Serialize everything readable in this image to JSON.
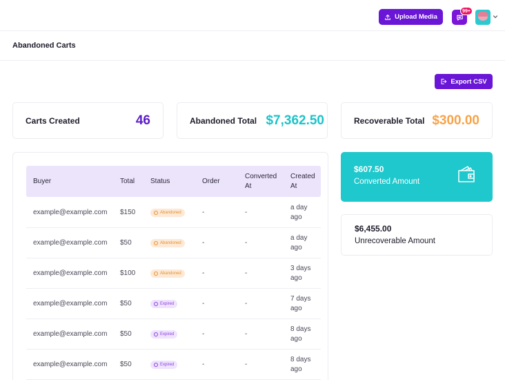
{
  "topbar": {
    "upload_label": "Upload Media",
    "notification_count": "99+",
    "upload_icon": "upload-icon",
    "message_icon": "message-icon",
    "avatar_icon": "user-avatar",
    "chevron_icon": "chevron-down-icon"
  },
  "page": {
    "title": "Abandoned Carts",
    "export_label": "Export CSV",
    "export_icon": "export-icon"
  },
  "stats": {
    "carts_created": {
      "label": "Carts Created",
      "value": "46",
      "color": "#5b1cc7"
    },
    "abandoned_total": {
      "label": "Abandoned Total",
      "value": "$7,362.50",
      "color": "#1cc3c9"
    },
    "recoverable_total": {
      "label": "Recoverable Total",
      "value": "$300.00",
      "color": "#f7a349"
    }
  },
  "table": {
    "columns": [
      "Buyer",
      "Total",
      "Status",
      "Order",
      "Converted At",
      "Created At"
    ],
    "rows": [
      {
        "buyer": "example@example.com",
        "total": "$150",
        "status": "Abandoned",
        "order": "-",
        "converted_at": "-",
        "created_at": "a day ago"
      },
      {
        "buyer": "example@example.com",
        "total": "$50",
        "status": "Abandoned",
        "order": "-",
        "converted_at": "-",
        "created_at": "a day ago"
      },
      {
        "buyer": "example@example.com",
        "total": "$100",
        "status": "Abandoned",
        "order": "-",
        "converted_at": "-",
        "created_at": "3 days ago"
      },
      {
        "buyer": "example@example.com",
        "total": "$50",
        "status": "Expired",
        "order": "-",
        "converted_at": "-",
        "created_at": "7 days ago"
      },
      {
        "buyer": "example@example.com",
        "total": "$50",
        "status": "Expired",
        "order": "-",
        "converted_at": "-",
        "created_at": "8 days ago"
      },
      {
        "buyer": "example@example.com",
        "total": "$50",
        "status": "Expired",
        "order": "-",
        "converted_at": "-",
        "created_at": "8 days ago"
      }
    ]
  },
  "summary": {
    "converted": {
      "value": "$607.50",
      "label": "Converted Amount",
      "icon": "wallet-icon",
      "color": "#1ec8cc"
    },
    "unrecoverable": {
      "value": "$6,455.00",
      "label": "Unrecoverable Amount"
    }
  },
  "colors": {
    "primary": "#6a16d6",
    "abandoned_badge": "#e3922e",
    "expired_badge": "#8b3fe0"
  }
}
